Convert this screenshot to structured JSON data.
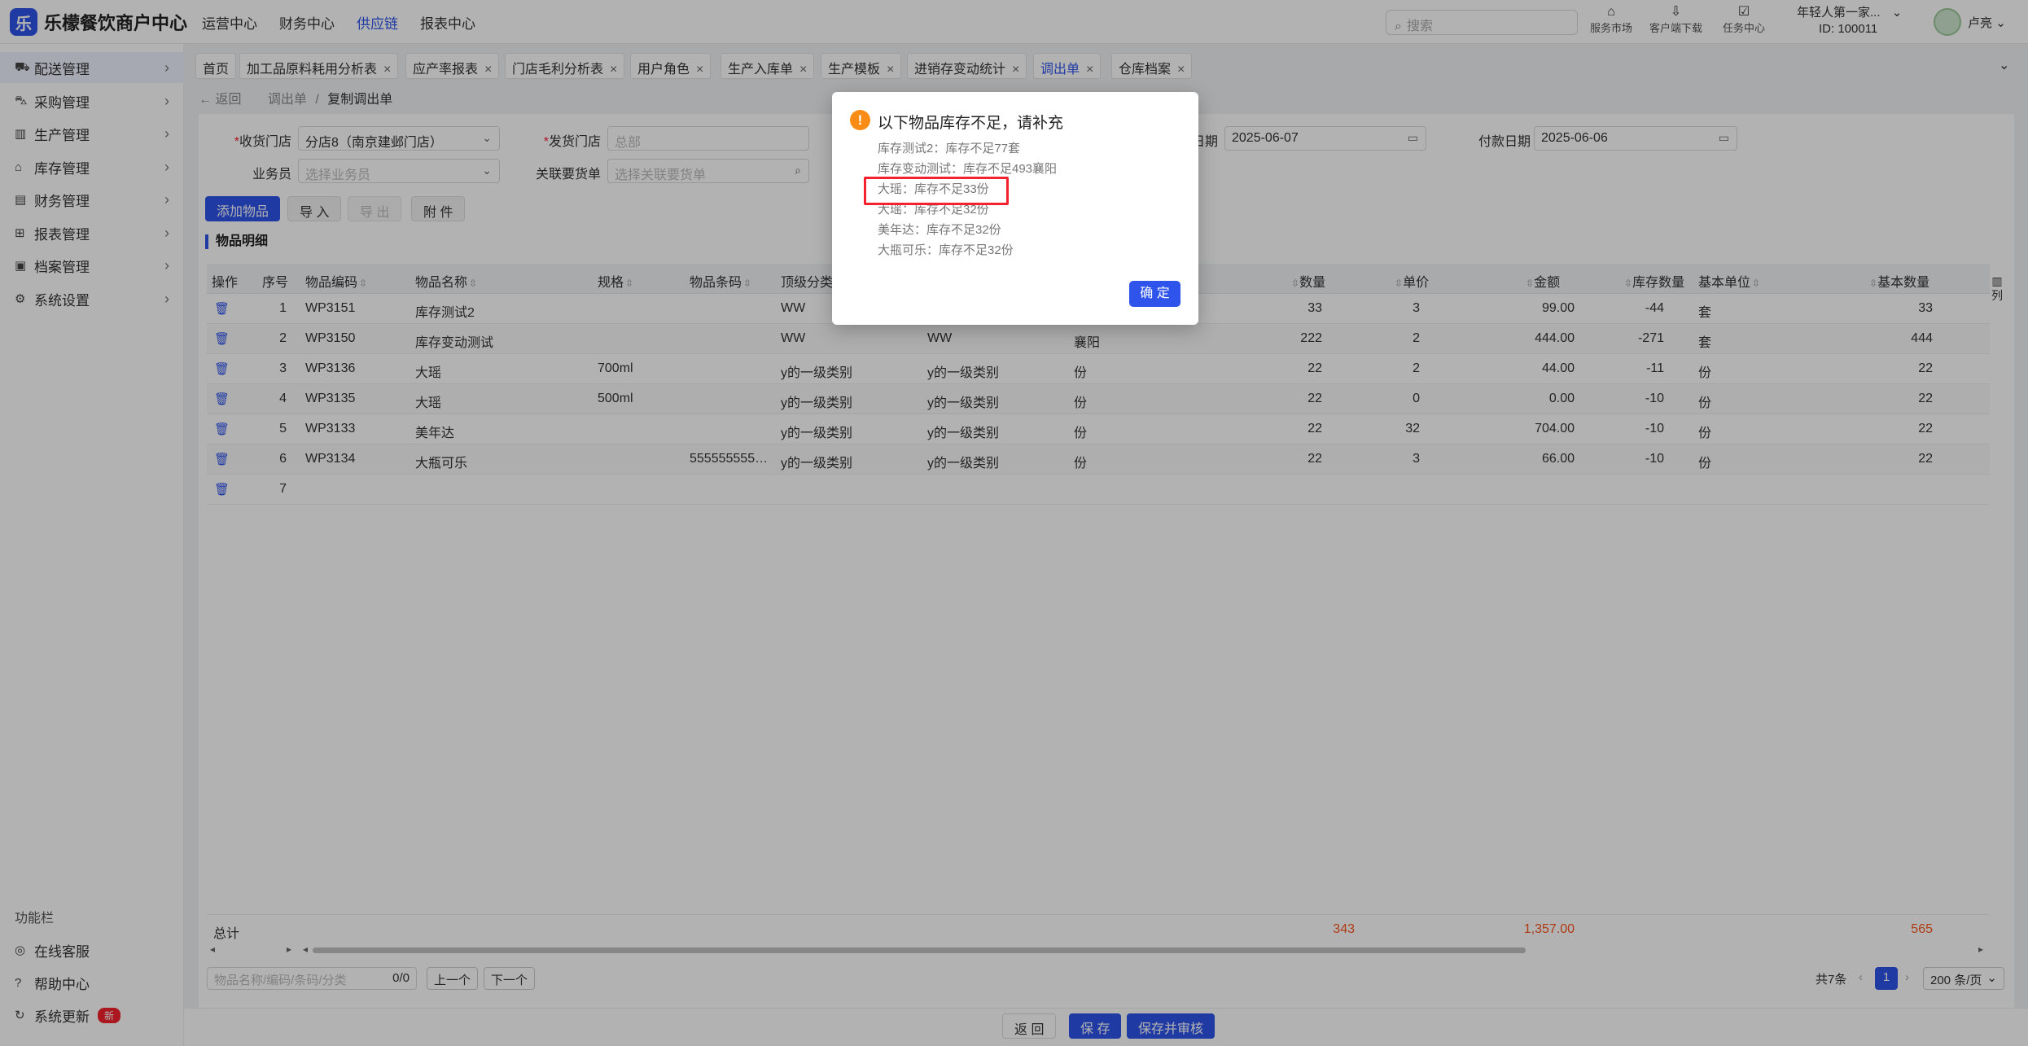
{
  "app": {
    "title": "乐檬餐饮商户中心",
    "logo_glyph": "乐"
  },
  "topnav": [
    "运营中心",
    "财务中心",
    "供应链",
    "报表中心"
  ],
  "topnav_active": 2,
  "search": {
    "placeholder": "搜索"
  },
  "top_tools": [
    {
      "icon": "market-icon",
      "glyph": "⌂",
      "label": "服务市场"
    },
    {
      "icon": "download-icon",
      "glyph": "⇩",
      "label": "客户端下载"
    },
    {
      "icon": "task-icon",
      "glyph": "☑",
      "label": "任务中心"
    }
  ],
  "user": {
    "company": "年轻人第一家...",
    "id": "ID: 100011",
    "name": "卢亮"
  },
  "sidebar": {
    "items": [
      {
        "icon": "truck-icon",
        "glyph": "⛟",
        "label": "配送管理"
      },
      {
        "icon": "cart-icon",
        "glyph": "⛍",
        "label": "采购管理"
      },
      {
        "icon": "chart-icon",
        "glyph": "▥",
        "label": "生产管理"
      },
      {
        "icon": "warehouse-icon",
        "glyph": "⌂",
        "label": "库存管理"
      },
      {
        "icon": "finance-icon",
        "glyph": "▤",
        "label": "财务管理"
      },
      {
        "icon": "report-icon",
        "glyph": "⊞",
        "label": "报表管理"
      },
      {
        "icon": "archive-icon",
        "glyph": "▣",
        "label": "档案管理"
      },
      {
        "icon": "settings-icon",
        "glyph": "⚙",
        "label": "系统设置"
      }
    ],
    "footer_title": "功能栏",
    "footer": [
      {
        "icon": "service-icon",
        "glyph": "◎",
        "label": "在线客服"
      },
      {
        "icon": "help-icon",
        "glyph": "?",
        "label": "帮助中心"
      },
      {
        "icon": "update-icon",
        "glyph": "↻",
        "label": "系统更新",
        "badge": "新"
      }
    ]
  },
  "tabs": [
    "首页",
    "加工品原料耗用分析表",
    "应产率报表",
    "门店毛利分析表",
    "用户角色",
    "生产入库单",
    "生产模板",
    "进销存变动统计",
    "调出单",
    "仓库档案"
  ],
  "tabs_active": 8,
  "breadcrumb": {
    "back": "← 返回",
    "parent": "调出单",
    "sep": "/",
    "current": "复制调出单"
  },
  "form": {
    "receive_store_label": "收货门店",
    "receive_store_value": "分店8（南京建邺门店）",
    "send_store_label": "发货门店",
    "send_store_placeholder": "总部",
    "date1_label": "日期",
    "date1_value": "2025-06-07",
    "pay_date_label": "付款日期",
    "pay_date_value": "2025-06-06",
    "salesman_label": "业务员",
    "salesman_placeholder": "选择业务员",
    "related_label": "关联要货单",
    "related_placeholder": "选择关联要货单"
  },
  "actions": {
    "add": "添加物品",
    "import": "导 入",
    "export": "导 出",
    "attach": "附 件"
  },
  "section_title": "物品明细",
  "table": {
    "headers": {
      "op": "操作",
      "seq": "序号",
      "code": "物品编码",
      "name": "物品名称",
      "spec": "规格",
      "barcode": "物品条码",
      "top_cat": "顶级分类",
      "qty": "数量",
      "price": "单价",
      "amount": "金额",
      "stock": "库存数量",
      "base_unit": "基本单位",
      "base_qty": "基本数量"
    },
    "rows": [
      {
        "seq": "1",
        "code": "WP3151",
        "name": "库存测试2",
        "spec": "",
        "barcode": "",
        "top_cat": "WW",
        "cat2": "",
        "cat3": "",
        "qty": "33",
        "price": "3",
        "amount": "99.00",
        "stock": "-44",
        "unit": "套",
        "base_qty": "33"
      },
      {
        "seq": "2",
        "code": "WP3150",
        "name": "库存变动测试",
        "spec": "",
        "barcode": "",
        "top_cat": "WW",
        "cat2": "WW",
        "cat3": "襄阳",
        "qty": "222",
        "price": "2",
        "amount": "444.00",
        "stock": "-271",
        "unit": "套",
        "base_qty": "444"
      },
      {
        "seq": "3",
        "code": "WP3136",
        "name": "大瑶",
        "spec": "700ml",
        "barcode": "",
        "top_cat": "y的一级类别",
        "cat2": "y的一级类别",
        "cat3": "份",
        "qty": "22",
        "price": "2",
        "amount": "44.00",
        "stock": "-11",
        "unit": "份",
        "base_qty": "22"
      },
      {
        "seq": "4",
        "code": "WP3135",
        "name": "大瑶",
        "spec": "500ml",
        "barcode": "",
        "top_cat": "y的一级类别",
        "cat2": "y的一级类别",
        "cat3": "份",
        "qty": "22",
        "price": "0",
        "amount": "0.00",
        "stock": "-10",
        "unit": "份",
        "base_qty": "22"
      },
      {
        "seq": "5",
        "code": "WP3133",
        "name": "美年达",
        "spec": "",
        "barcode": "",
        "top_cat": "y的一级类别",
        "cat2": "y的一级类别",
        "cat3": "份",
        "qty": "22",
        "price": "32",
        "amount": "704.00",
        "stock": "-10",
        "unit": "份",
        "base_qty": "22"
      },
      {
        "seq": "6",
        "code": "WP3134",
        "name": "大瓶可乐",
        "spec": "",
        "barcode": "555555555…",
        "top_cat": "y的一级类别",
        "cat2": "y的一级类别",
        "cat3": "份",
        "qty": "22",
        "price": "3",
        "amount": "66.00",
        "stock": "-10",
        "unit": "份",
        "base_qty": "22"
      },
      {
        "seq": "7",
        "code": "",
        "name": "",
        "spec": "",
        "barcode": "",
        "top_cat": "",
        "cat2": "",
        "cat3": "",
        "qty": "",
        "price": "",
        "amount": "",
        "stock": "",
        "unit": "",
        "base_qty": ""
      }
    ],
    "column_setting": "列",
    "total_label": "总计",
    "total_qty": "343",
    "total_amount": "1,357.00",
    "total_base_qty": "565"
  },
  "find": {
    "placeholder": "物品名称/编码/条码/分类",
    "count": "0/0",
    "prev": "上一个",
    "next": "下一个"
  },
  "pager": {
    "total": "共7条",
    "current": "1",
    "size": "200 条/页"
  },
  "footer_buttons": {
    "back": "返 回",
    "save": "保 存",
    "save_audit": "保存并审核"
  },
  "modal": {
    "title": "以下物品库存不足，请补充",
    "lines": [
      "库存测试2：库存不足77套",
      "库存变动测试：库存不足493襄阳",
      "大瑶：库存不足33份",
      "大瑶：库存不足32份",
      "美年达：库存不足32份",
      "大瓶可乐：库存不足32份"
    ],
    "ok": "确 定",
    "highlighted_line": 2
  },
  "colors": {
    "primary": "#2f54eb",
    "warning": "#fa8c16",
    "highlight": "#f5222d",
    "total": "#fa541c"
  }
}
